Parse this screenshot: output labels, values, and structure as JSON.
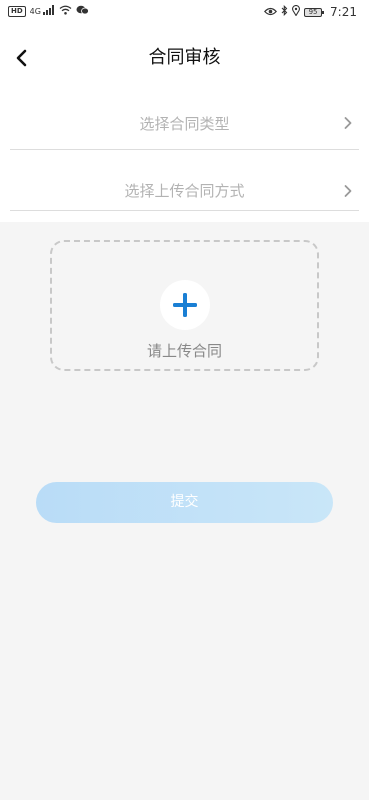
{
  "status_bar": {
    "hd_badge": "HD",
    "signal_text": "4G",
    "battery_level": "95",
    "time": "7:21",
    "left_icons": [
      "hd-icon",
      "signal-icon",
      "wifi-icon",
      "wechat-icon"
    ],
    "right_icons": [
      "eye-icon",
      "bluetooth-icon",
      "location-icon",
      "battery-icon"
    ]
  },
  "header": {
    "title": "合同审核",
    "back_icon": "chevron-left-icon"
  },
  "form": {
    "contract_type_label": "选择合同类型",
    "upload_method_label": "选择上传合同方式",
    "chevron_icon": "chevron-right-icon"
  },
  "upload": {
    "label": "请上传合同",
    "icon": "plus-icon",
    "accent_color": "#1a7fd4"
  },
  "actions": {
    "submit_label": "提交"
  },
  "colors": {
    "background": "#f5f5f5",
    "placeholder_text": "#b3b3b3",
    "submit_gradient_start": "#b9dcf7",
    "submit_gradient_end": "#c9e6f8"
  }
}
